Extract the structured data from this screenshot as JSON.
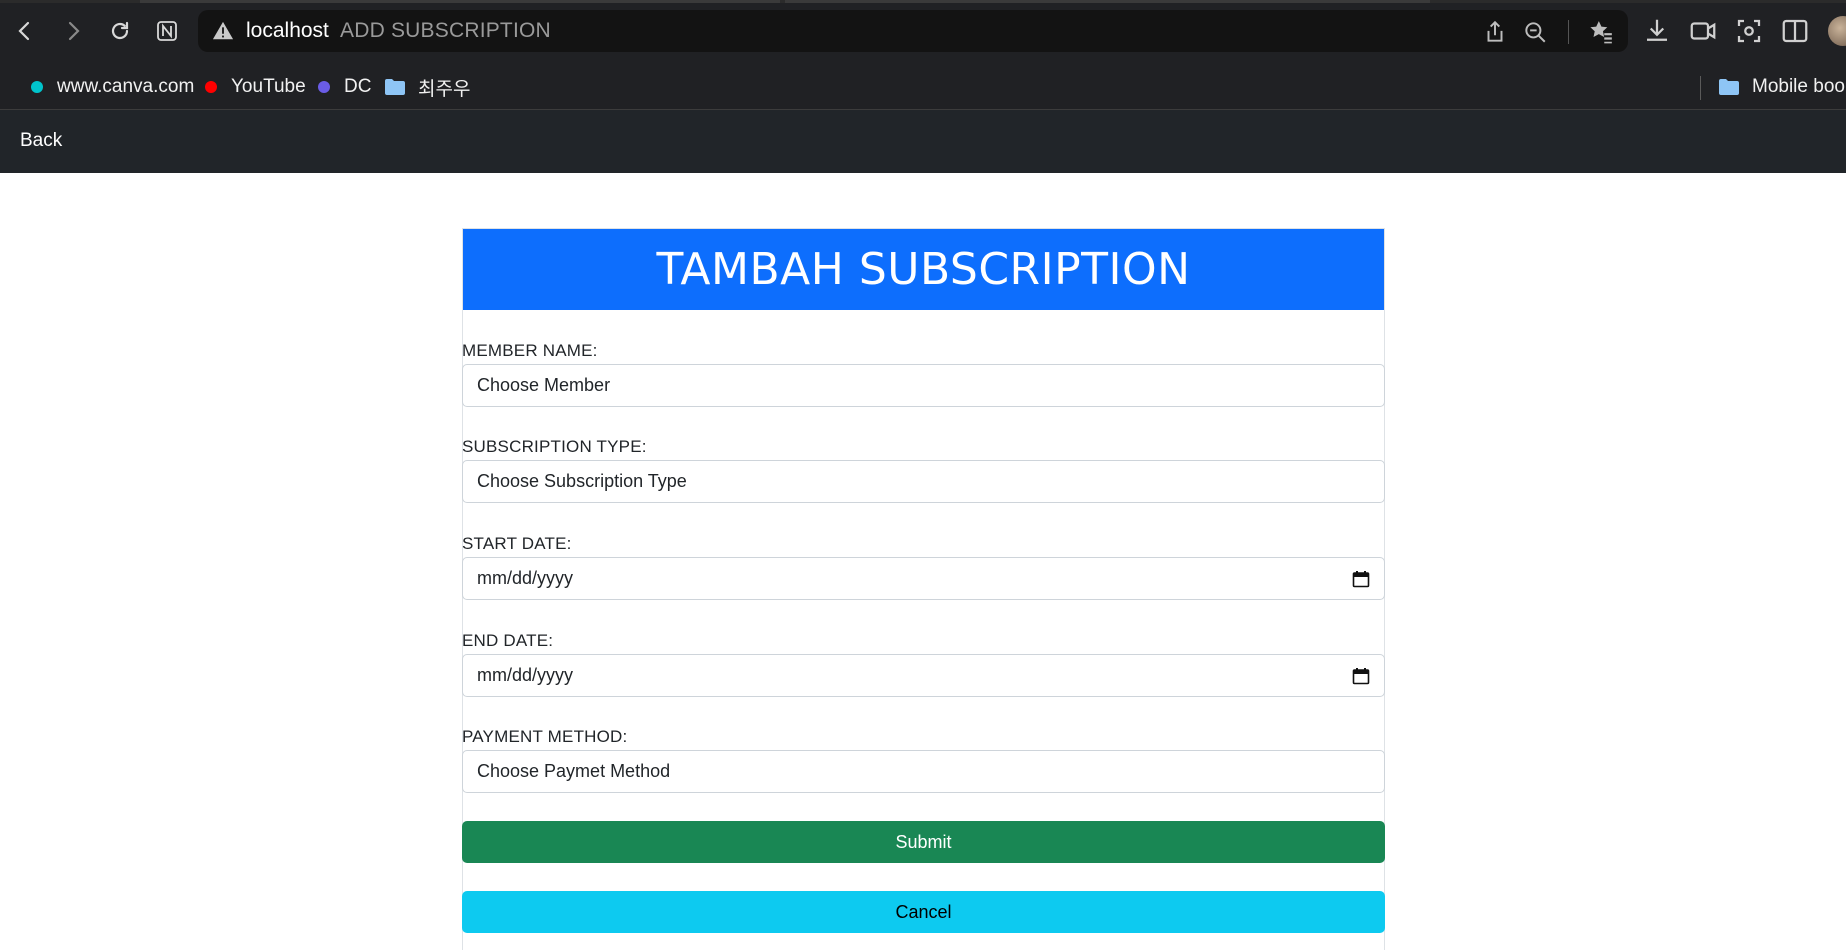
{
  "browser": {
    "host": "localhost",
    "page_title": "ADD SUBSCRIPTION",
    "icons": {
      "back": "chevron-left-icon",
      "forward": "chevron-right-icon",
      "reload": "reload-icon",
      "notion": "notion-icon",
      "warning": "warning-triangle-icon",
      "share": "share-icon",
      "zoom_out": "zoom-out-icon",
      "favorites": "favorites-icon",
      "download": "download-icon",
      "video": "video-icon",
      "screenshot": "screenshot-icon",
      "split": "split-view-icon"
    },
    "bookmarks": [
      {
        "label": "www.canva.com",
        "dot_color": "#00c4cc"
      },
      {
        "label": "YouTube",
        "dot_color": "#ff0000"
      },
      {
        "label": "DC",
        "dot_color": "#6a5ce6"
      },
      {
        "label": "최주우",
        "icon": "folder-icon"
      }
    ],
    "bookmarks_right": {
      "label": "Mobile boo",
      "icon": "folder-icon"
    }
  },
  "app_nav": {
    "back_label": "Back"
  },
  "form": {
    "heading": "TAMBAH SUBSCRIPTION",
    "fields": [
      {
        "label": "MEMBER NAME:",
        "value": "Choose Member",
        "type": "select"
      },
      {
        "label": "SUBSCRIPTION TYPE:",
        "value": "Choose Subscription Type",
        "type": "select"
      },
      {
        "label": "START DATE:",
        "value": "mm/dd/yyyy",
        "type": "date",
        "icon": "calendar-icon"
      },
      {
        "label": "END DATE:",
        "value": "mm/dd/yyyy",
        "type": "date",
        "icon": "calendar-icon"
      },
      {
        "label": "PAYMENT METHOD:",
        "value": "Choose Paymet Method",
        "type": "select"
      }
    ],
    "submit_label": "Submit",
    "cancel_label": "Cancel"
  },
  "colors": {
    "header": "#0d6efd",
    "submit": "#198754",
    "cancel": "#0dcaf0",
    "navbar": "#212529"
  }
}
